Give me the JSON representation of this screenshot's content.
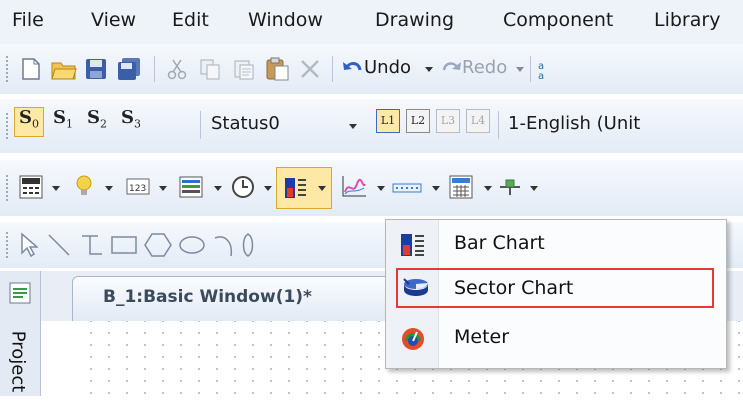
{
  "menubar": {
    "items": [
      "File",
      "View",
      "Edit",
      "Window",
      "Drawing",
      "Component",
      "Library"
    ]
  },
  "edit_toolbar": {
    "undo_label": "Undo",
    "redo_label": "Redo"
  },
  "status_toolbar": {
    "states": [
      "S0",
      "S1",
      "S2",
      "S3"
    ],
    "status_value": "Status0",
    "layers": [
      "L1",
      "L2",
      "L3",
      "L4"
    ],
    "language_value": "1-English (Unit"
  },
  "component_toolbar": {
    "numeric_icon_text": "123"
  },
  "tab": {
    "title": "B_1:Basic Window(1)*"
  },
  "side_panel": {
    "label": "Project"
  },
  "dropdown": {
    "items": [
      {
        "label": "Bar Chart",
        "icon": "bar-chart-icon"
      },
      {
        "label": "Sector Chart",
        "icon": "sector-chart-icon"
      },
      {
        "label": "Meter",
        "icon": "meter-icon"
      }
    ],
    "highlight_color": "#e53935"
  },
  "colors": {
    "toolbar_bg": "#e3ebf6",
    "active_button_bg": "#fde9a5",
    "accent": "#3a6fd8"
  }
}
